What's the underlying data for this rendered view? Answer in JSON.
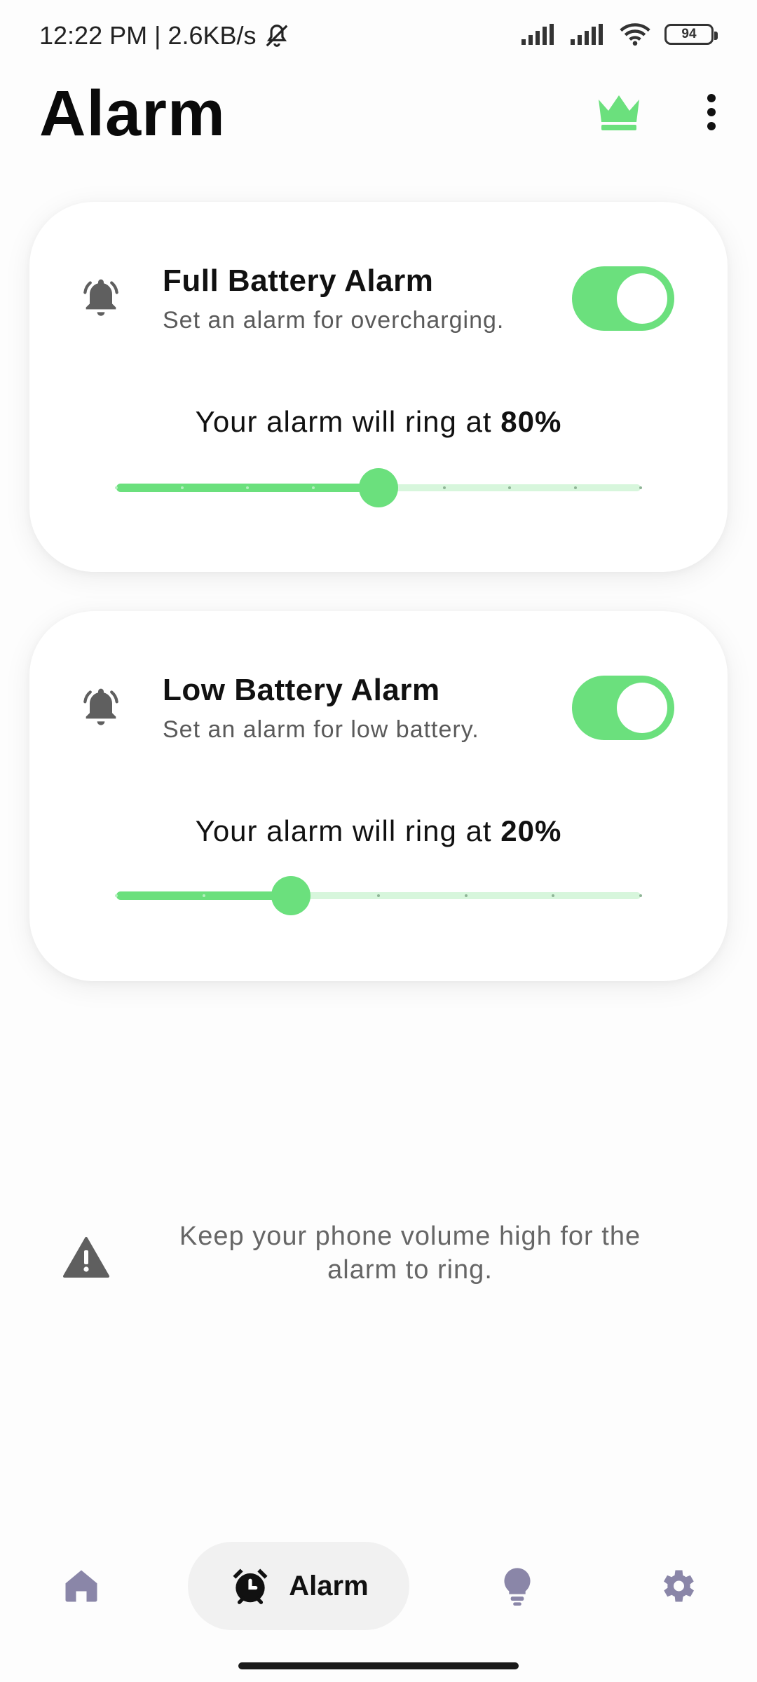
{
  "status_bar": {
    "time_speed": "12:22 PM | 2.6KB/s",
    "battery_level": "94",
    "icons": [
      "mute-bell-icon",
      "signal-icon",
      "signal-icon",
      "wifi-icon",
      "battery-icon"
    ]
  },
  "header": {
    "title": "Alarm",
    "icons": [
      "crown-icon",
      "more-vert-icon"
    ]
  },
  "cards": [
    {
      "title": "Full Battery Alarm",
      "subtitle": "Set an alarm for overcharging.",
      "enabled": true,
      "ring_prefix": "Your alarm will ring at",
      "ring_value": "80%",
      "slider_level": 0.5,
      "slider_steps": 8
    },
    {
      "title": "Low Battery Alarm",
      "subtitle": "Set an alarm for low battery.",
      "enabled": true,
      "ring_prefix": "Your alarm will ring at",
      "ring_value": "20%",
      "slider_level": 0.333,
      "slider_steps": 6
    }
  ],
  "warning": {
    "text": "Keep your phone volume high for the alarm to ring.",
    "icon": "warning-icon"
  },
  "bottom_nav": {
    "items": [
      {
        "id": "home",
        "icon": "home-icon"
      },
      {
        "id": "alarm",
        "icon": "alarm-clock-icon",
        "label": "Alarm",
        "active": true
      },
      {
        "id": "tips",
        "icon": "lightbulb-icon"
      },
      {
        "id": "settings",
        "icon": "gear-icon"
      }
    ]
  },
  "colors": {
    "accent": "#6be07d",
    "accent_light": "#d7f6dc",
    "icon_gray": "#5f5f5f",
    "nav_icon": "#8a86a8"
  }
}
